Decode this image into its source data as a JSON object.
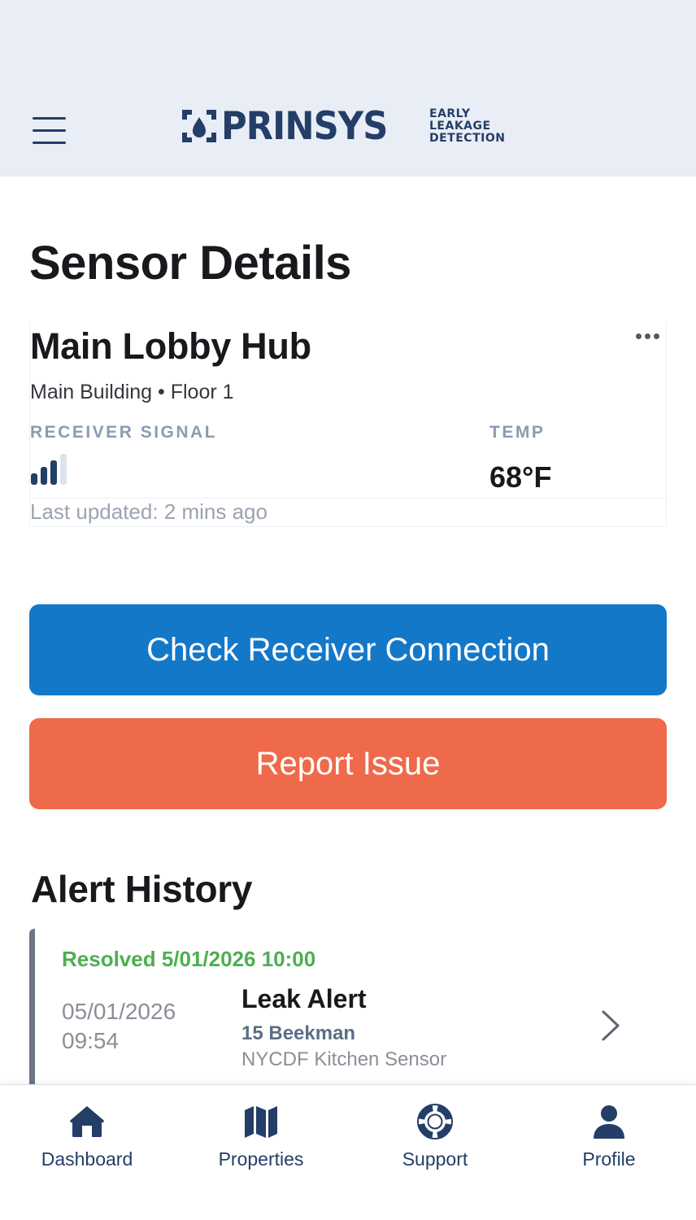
{
  "header": {
    "logo_text": "PRINSYS",
    "logo_tagline": [
      "EARLY",
      "LEAKAGE",
      "DETECTION"
    ]
  },
  "page": {
    "title": "Sensor Details"
  },
  "sensor": {
    "name": "Main Lobby Hub",
    "location": "Main Building • Floor 1",
    "signal_label": "RECEIVER SIGNAL",
    "signal_bars_active": 3,
    "signal_bars_total": 4,
    "temp_label": "TEMP",
    "temp_value": "68°F",
    "last_updated": "Last updated: 2 mins ago"
  },
  "actions": {
    "check_label": "Check Receiver Connection",
    "report_label": "Report Issue"
  },
  "alerts": {
    "title": "Alert History",
    "items": [
      {
        "status": "Resolved 5/01/2026 10:00",
        "date": "05/01/2026",
        "time": "09:54",
        "title": "Leak Alert",
        "property": "15 Beekman",
        "sensor": "NYCDF Kitchen Sensor"
      }
    ]
  },
  "nav": {
    "items": [
      {
        "label": "Dashboard",
        "icon": "home-icon"
      },
      {
        "label": "Properties",
        "icon": "map-icon"
      },
      {
        "label": "Support",
        "icon": "lifebuoy-icon"
      },
      {
        "label": "Profile",
        "icon": "person-icon"
      }
    ]
  },
  "colors": {
    "brand_navy": "#233e67",
    "primary_blue": "#1478c9",
    "danger_orange": "#ee6a4b",
    "resolved_green": "#4caf50",
    "header_bg": "#e9edf5"
  }
}
